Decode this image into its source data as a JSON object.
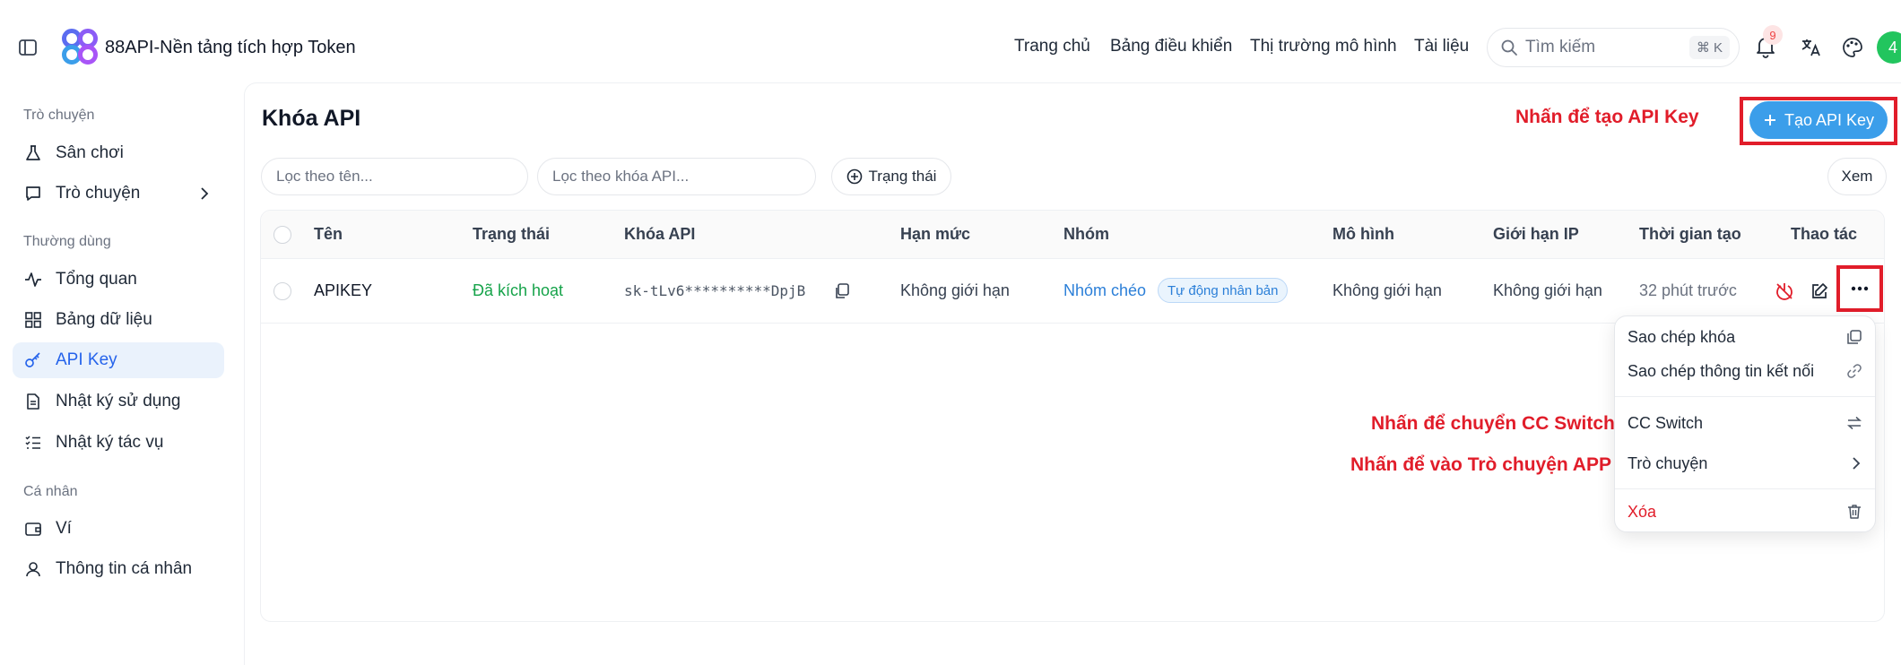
{
  "header": {
    "title": "88API-Nền tảng tích hợp Token",
    "nav": [
      "Trang chủ",
      "Bảng điều khiển",
      "Thị trường mô hình",
      "Tài liệu"
    ],
    "search_placeholder": "Tìm kiếm",
    "search_shortcut": "⌘ K",
    "notification_count": "9",
    "avatar_text": "4"
  },
  "sidebar": {
    "sections": [
      {
        "label": "Trò chuyện",
        "items": [
          {
            "label": "Sân chơi",
            "icon": "flask-icon"
          },
          {
            "label": "Trò chuyện",
            "icon": "chat-icon"
          }
        ]
      },
      {
        "label": "Thường dùng",
        "items": [
          {
            "label": "Tổng quan",
            "icon": "activity-icon"
          },
          {
            "label": "Bảng dữ liệu",
            "icon": "grid-icon"
          },
          {
            "label": "API Key",
            "icon": "key-icon",
            "active": true
          },
          {
            "label": "Nhật ký sử dụng",
            "icon": "document-icon"
          },
          {
            "label": "Nhật ký tác vụ",
            "icon": "list-icon"
          }
        ]
      },
      {
        "label": "Cá nhân",
        "items": [
          {
            "label": "Ví",
            "icon": "wallet-icon"
          },
          {
            "label": "Thông tin cá nhân",
            "icon": "user-icon"
          }
        ]
      }
    ]
  },
  "main": {
    "title": "Khóa API",
    "create_button": "Tạo API Key",
    "filter_name_placeholder": "Lọc theo tên...",
    "filter_key_placeholder": "Lọc theo khóa API...",
    "status_filter": "Trạng thái",
    "view_button": "Xem",
    "annotations": {
      "create": "Nhấn để tạo API Key",
      "cc_switch": "Nhấn để chuyển CC Switch",
      "chat_app": "Nhấn để vào Trò chuyện APP"
    },
    "table": {
      "columns": [
        "Tên",
        "Trạng thái",
        "Khóa API",
        "Hạn mức",
        "Nhóm",
        "Mô hình",
        "Giới hạn IP",
        "Thời gian tạo",
        "Thao tác"
      ],
      "rows": [
        {
          "name": "APIKEY",
          "status": "Đã kích hoạt",
          "key": "sk-tLv6**********DpjB",
          "quota": "Không giới hạn",
          "group": "Nhóm chéo",
          "group_tag": "Tự động nhân bản",
          "model": "Không giới hạn",
          "ip_limit": "Không giới hạn",
          "created": "32 phút trước"
        }
      ]
    },
    "menu": [
      "Sao chép khóa",
      "Sao chép thông tin kết nối",
      "CC Switch",
      "Trò chuyện",
      "Xóa"
    ]
  },
  "colors": {
    "accent": "#3b9eea",
    "active_text": "#2563eb",
    "status_green": "#16a34a",
    "annotation_red": "#e11d2a"
  }
}
